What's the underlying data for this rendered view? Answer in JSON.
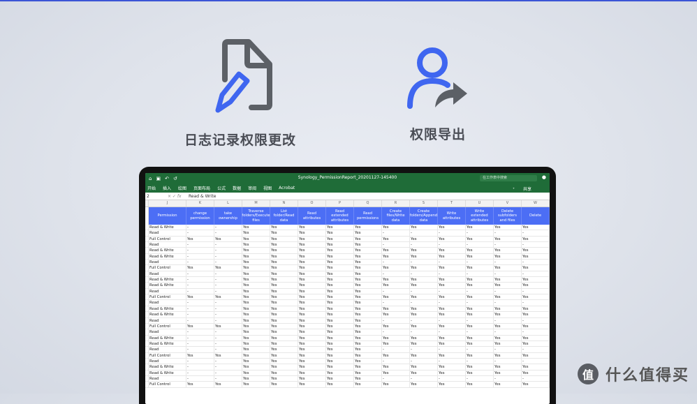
{
  "features": [
    {
      "label": "日志记录权限更改",
      "icon": "document-edit-icon"
    },
    {
      "label": "权限导出",
      "icon": "user-share-icon"
    }
  ],
  "colors": {
    "accent": "#3f66f0",
    "icon_gray": "#5c6066",
    "excel_green": "#1f6c38",
    "header_blue": "#4c6ef5"
  },
  "excel": {
    "doc_title": "Synology_PermissionReport_20201127-145400",
    "search_placeholder": "在工作表中搜索",
    "share": "共享",
    "menu": [
      "开始",
      "插入",
      "绘图",
      "页面布局",
      "公式",
      "数据",
      "审阅",
      "视图",
      "Acrobat"
    ],
    "cell_ref": "2",
    "formula_value": "Read & Write",
    "columns": [
      "J",
      "K",
      "L",
      "M",
      "N",
      "O",
      "P",
      "Q",
      "R",
      "S",
      "T",
      "U",
      "V",
      "W"
    ],
    "headers": [
      "Permission",
      "change permission",
      "take ownership",
      "Traverse folders/Execute files",
      "List folder/Read data",
      "Read attributes",
      "Read extended attributes",
      "Read permissions",
      "Create files/Write data",
      "Create folders/Append data",
      "Write attributes",
      "Write extended attributes",
      "Delete subfolders and files",
      "Delete"
    ],
    "rows": [
      [
        "Read & Write",
        "-",
        "-",
        "Yes",
        "Yes",
        "Yes",
        "Yes",
        "Yes",
        "Yes",
        "Yes",
        "Yes",
        "Yes",
        "Yes",
        "Yes"
      ],
      [
        "Read",
        "-",
        "-",
        "Yes",
        "Yes",
        "Yes",
        "Yes",
        "Yes",
        "-",
        "-",
        "-",
        "-",
        "-",
        "-"
      ],
      [
        "Full Control",
        "Yes",
        "Yes",
        "Yes",
        "Yes",
        "Yes",
        "Yes",
        "Yes",
        "Yes",
        "Yes",
        "Yes",
        "Yes",
        "Yes",
        "Yes"
      ],
      [
        "Read",
        "-",
        "-",
        "Yes",
        "Yes",
        "Yes",
        "Yes",
        "Yes",
        "-",
        "-",
        "-",
        "-",
        "-",
        "-"
      ],
      [
        "Read & Write",
        "-",
        "-",
        "Yes",
        "Yes",
        "Yes",
        "Yes",
        "Yes",
        "Yes",
        "Yes",
        "Yes",
        "Yes",
        "Yes",
        "Yes"
      ],
      [
        "Read & Write",
        "-",
        "-",
        "Yes",
        "Yes",
        "Yes",
        "Yes",
        "Yes",
        "Yes",
        "Yes",
        "Yes",
        "Yes",
        "Yes",
        "Yes"
      ],
      [
        "Read",
        "-",
        "-",
        "Yes",
        "Yes",
        "Yes",
        "Yes",
        "Yes",
        "-",
        "-",
        "-",
        "-",
        "-",
        "-"
      ],
      [
        "Full Control",
        "Yes",
        "Yes",
        "Yes",
        "Yes",
        "Yes",
        "Yes",
        "Yes",
        "Yes",
        "Yes",
        "Yes",
        "Yes",
        "Yes",
        "Yes"
      ],
      [
        "Read",
        "-",
        "-",
        "Yes",
        "Yes",
        "Yes",
        "Yes",
        "Yes",
        "-",
        "-",
        "-",
        "-",
        "-",
        "-"
      ],
      [
        "Read & Write",
        "-",
        "-",
        "Yes",
        "Yes",
        "Yes",
        "Yes",
        "Yes",
        "Yes",
        "Yes",
        "Yes",
        "Yes",
        "Yes",
        "Yes"
      ],
      [
        "Read & Write",
        "-",
        "-",
        "Yes",
        "Yes",
        "Yes",
        "Yes",
        "Yes",
        "Yes",
        "Yes",
        "Yes",
        "Yes",
        "Yes",
        "Yes"
      ],
      [
        "Read",
        "-",
        "-",
        "Yes",
        "Yes",
        "Yes",
        "Yes",
        "Yes",
        "-",
        "-",
        "-",
        "-",
        "-",
        "-"
      ],
      [
        "Full Control",
        "Yes",
        "Yes",
        "Yes",
        "Yes",
        "Yes",
        "Yes",
        "Yes",
        "Yes",
        "Yes",
        "Yes",
        "Yes",
        "Yes",
        "Yes"
      ],
      [
        "Read",
        "-",
        "-",
        "Yes",
        "Yes",
        "Yes",
        "Yes",
        "Yes",
        "-",
        "-",
        "-",
        "-",
        "-",
        "-"
      ],
      [
        "Read & Write",
        "-",
        "-",
        "Yes",
        "Yes",
        "Yes",
        "Yes",
        "Yes",
        "Yes",
        "Yes",
        "Yes",
        "Yes",
        "Yes",
        "Yes"
      ],
      [
        "Read & Write",
        "-",
        "-",
        "Yes",
        "Yes",
        "Yes",
        "Yes",
        "Yes",
        "Yes",
        "Yes",
        "Yes",
        "Yes",
        "Yes",
        "Yes"
      ],
      [
        "Read",
        "-",
        "-",
        "Yes",
        "Yes",
        "Yes",
        "Yes",
        "Yes",
        "-",
        "-",
        "-",
        "-",
        "-",
        "-"
      ],
      [
        "Full Control",
        "Yes",
        "Yes",
        "Yes",
        "Yes",
        "Yes",
        "Yes",
        "Yes",
        "Yes",
        "Yes",
        "Yes",
        "Yes",
        "Yes",
        "Yes"
      ],
      [
        "Read",
        "-",
        "-",
        "Yes",
        "Yes",
        "Yes",
        "Yes",
        "Yes",
        "-",
        "-",
        "-",
        "-",
        "-",
        "-"
      ],
      [
        "Read & Write",
        "-",
        "-",
        "Yes",
        "Yes",
        "Yes",
        "Yes",
        "Yes",
        "Yes",
        "Yes",
        "Yes",
        "Yes",
        "Yes",
        "Yes"
      ],
      [
        "Read & Write",
        "-",
        "-",
        "Yes",
        "Yes",
        "Yes",
        "Yes",
        "Yes",
        "Yes",
        "Yes",
        "Yes",
        "Yes",
        "Yes",
        "Yes"
      ],
      [
        "Read",
        "-",
        "-",
        "Yes",
        "Yes",
        "Yes",
        "Yes",
        "Yes",
        "-",
        "-",
        "-",
        "-",
        "-",
        "-"
      ],
      [
        "Full Control",
        "Yes",
        "Yes",
        "Yes",
        "Yes",
        "Yes",
        "Yes",
        "Yes",
        "Yes",
        "Yes",
        "Yes",
        "Yes",
        "Yes",
        "Yes"
      ],
      [
        "Read",
        "-",
        "-",
        "Yes",
        "Yes",
        "Yes",
        "Yes",
        "Yes",
        "-",
        "-",
        "-",
        "-",
        "-",
        "-"
      ],
      [
        "Read & Write",
        "-",
        "-",
        "Yes",
        "Yes",
        "Yes",
        "Yes",
        "Yes",
        "Yes",
        "Yes",
        "Yes",
        "Yes",
        "Yes",
        "Yes"
      ],
      [
        "Read & Write",
        "-",
        "-",
        "Yes",
        "Yes",
        "Yes",
        "Yes",
        "Yes",
        "Yes",
        "Yes",
        "Yes",
        "Yes",
        "Yes",
        "Yes"
      ],
      [
        "Read",
        "-",
        "-",
        "Yes",
        "Yes",
        "Yes",
        "Yes",
        "Yes",
        "-",
        "-",
        "-",
        "-",
        "-",
        "-"
      ],
      [
        "Full Control",
        "Yes",
        "Yes",
        "Yes",
        "Yes",
        "Yes",
        "Yes",
        "Yes",
        "Yes",
        "Yes",
        "Yes",
        "Yes",
        "Yes",
        "Yes"
      ]
    ]
  },
  "watermark": {
    "text": "什么值得买",
    "logo_char": "值"
  }
}
